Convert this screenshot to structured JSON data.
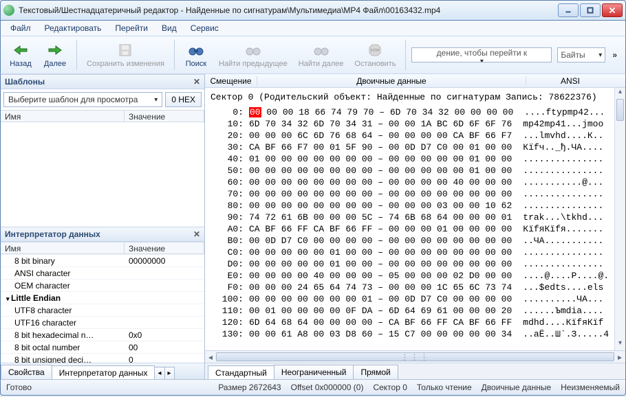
{
  "title": "Текстовый/Шестнадцатеричный редактор - Найденные по сигнатурам\\Мультимедиа\\MP4 Файл\\00163432.mp4",
  "menu": [
    "Файл",
    "Редактировать",
    "Перейти",
    "Вид",
    "Сервис"
  ],
  "toolbar": {
    "back": "Назад",
    "forward": "Далее",
    "save": "Сохранить изменения",
    "find": "Поиск",
    "findPrev": "Найти предыдущее",
    "findNext": "Найти далее",
    "stop": "Остановить",
    "goto_placeholder": "дение, чтобы перейти к",
    "units": "Байты"
  },
  "templates": {
    "title": "Шаблоны",
    "selector": "Выберите шаблон для просмотра",
    "hex_btn": "0 HEX",
    "col_name": "Имя",
    "col_value": "Значение"
  },
  "interp": {
    "title": "Интерпретатор данных",
    "col_name": "Имя",
    "col_value": "Значение",
    "rows": [
      {
        "k": "8 bit binary",
        "v": "00000000"
      },
      {
        "k": "ANSI character",
        "v": ""
      },
      {
        "k": "OEM character",
        "v": ""
      },
      {
        "k": "Little Endian",
        "v": "",
        "bold": true
      },
      {
        "k": "UTF8 character",
        "v": ""
      },
      {
        "k": "UTF16 character",
        "v": ""
      },
      {
        "k": "8 bit hexadecimal n…",
        "v": "0x0"
      },
      {
        "k": "8 bit octal number",
        "v": "00"
      },
      {
        "k": "8 bit unsigned deci…",
        "v": "0"
      }
    ],
    "tab_props": "Свойства",
    "tab_interp": "Интерпретатор данных"
  },
  "hex": {
    "h_offset": "Смещение",
    "h_bin": "Двоичные данные",
    "h_ansi": "ANSI",
    "sector": "Сектор 0 (Родительский объект: Найденные по сигнатурам Запись: 78622376)",
    "rows": [
      {
        "o": "0:",
        "b_pre": "",
        "hl": "00",
        "b_post": " 00 00 18 66 74 79 70 – 6D 70 34 32 00 00 00 00",
        "a": "....ftypmp42..."
      },
      {
        "o": "10:",
        "b": "6D 70 34 32 6D 70 34 31 – 00 00 1A BC 6D 6F 6F 76",
        "a": "mp42mp41...јmoo"
      },
      {
        "o": "20:",
        "b": "00 00 00 6C 6D 76 68 64 – 00 00 00 00 CA BF 66 F7",
        "a": "...lmvhd....К.."
      },
      {
        "o": "30:",
        "b": "CA BF 66 F7 00 01 5F 90 – 00 0D D7 C0 00 01 00 00",
        "a": "Кїfч.._ђ.ЧА...."
      },
      {
        "o": "40:",
        "b": "01 00 00 00 00 00 00 00 – 00 00 00 00 00 01 00 00",
        "a": "..............."
      },
      {
        "o": "50:",
        "b": "00 00 00 00 00 00 00 00 – 00 00 00 00 00 01 00 00",
        "a": "..............."
      },
      {
        "o": "60:",
        "b": "00 00 00 00 00 00 00 00 – 00 00 00 00 40 00 00 00",
        "a": "...........@..."
      },
      {
        "o": "70:",
        "b": "00 00 00 00 00 00 00 00 – 00 00 00 00 00 00 00 00",
        "a": "..............."
      },
      {
        "o": "80:",
        "b": "00 00 00 00 00 00 00 00 – 00 00 00 03 00 00 10 62",
        "a": "..............."
      },
      {
        "o": "90:",
        "b": "74 72 61 6B 00 00 00 5C – 74 6B 68 64 00 00 00 01",
        "a": "trak...\\tkhd..."
      },
      {
        "o": "A0:",
        "b": "CA BF 66 FF CA BF 66 FF – 00 00 00 01 00 00 00 00",
        "a": "КїfяКїfя......."
      },
      {
        "o": "B0:",
        "b": "00 0D D7 C0 00 00 00 00 – 00 00 00 00 00 00 00 00",
        "a": "..ЧА..........."
      },
      {
        "o": "C0:",
        "b": "00 00 00 00 00 01 00 00 – 00 00 00 00 00 00 00 00",
        "a": "..............."
      },
      {
        "o": "D0:",
        "b": "00 00 00 00 00 01 00 00 – 00 00 00 00 00 00 00 00",
        "a": "..............."
      },
      {
        "o": "E0:",
        "b": "00 00 00 00 40 00 00 00 – 05 00 00 00 02 D0 00 00",
        "a": "....@....Р....@."
      },
      {
        "o": "F0:",
        "b": "00 00 00 24 65 64 74 73 – 00 00 00 1C 65 6C 73 74",
        "a": "...$edts....els"
      },
      {
        "o": "100:",
        "b": "00 00 00 00 00 00 00 01 – 00 0D D7 C0 00 00 00 00",
        "a": "..........ЧА..."
      },
      {
        "o": "110:",
        "b": "00 01 00 00 00 00 0F DA – 6D 64 69 61 00 00 00 20",
        "a": "......Ъmdia...."
      },
      {
        "o": "120:",
        "b": "6D 64 68 64 00 00 00 00 – CA BF 66 FF CA BF 66 FF",
        "a": "mdhd....КїfяКїf"
      },
      {
        "o": "130:",
        "b": "00 00 61 A8 00 03 D8 60 – 15 C7 00 00 00 00 00 34",
        "a": "..aЁ..Ш`.З.....4"
      }
    ],
    "tab_std": "Стандартный",
    "tab_unl": "Неограниченный",
    "tab_direct": "Прямой"
  },
  "status": {
    "ready": "Готово",
    "size": "Размер 2672643",
    "offset": "Offset 0x000000 (0)",
    "sec": "Сектор 0",
    "ro": "Только чтение",
    "bin": "Двоичные данные",
    "immut": "Неизменяемый"
  }
}
